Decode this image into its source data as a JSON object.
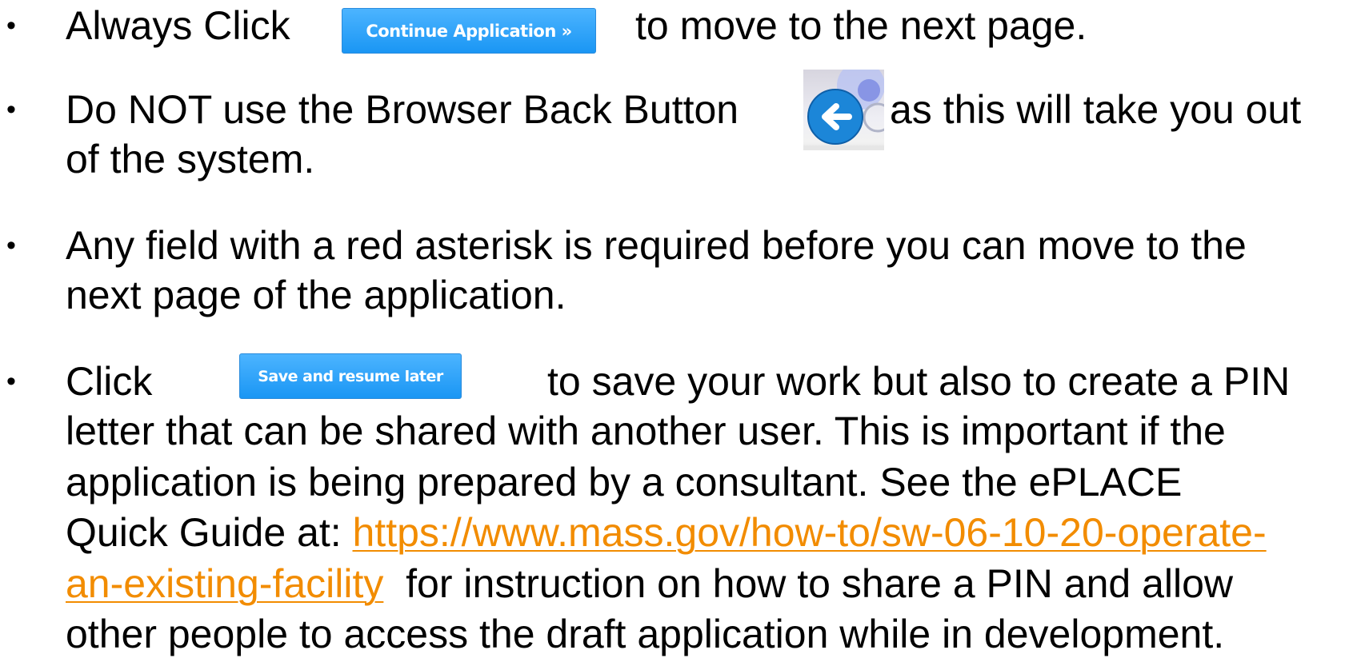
{
  "bullet_char": "•",
  "items": [
    {
      "before": "Always Click",
      "button_label": "Continue Application »",
      "after": "to move to the next page."
    },
    {
      "before": "Do NOT use the Browser Back Button",
      "icon": "browser-back-arrow-icon",
      "after": "as this will take you out",
      "line2": "of the system."
    },
    {
      "line1": "Any field with a red asterisk is required before you can move to the",
      "line2": "next page of the application."
    },
    {
      "before": "Click",
      "button_label": "Save and resume later",
      "after": "to save your work but also to create a PIN",
      "line2": "letter that can be shared with another user. This is important if the",
      "line3": "application is being prepared by a consultant. See the ePLACE",
      "line4_text": "Quick Guide at: ",
      "link_part1": "https://www.mass.gov/how-to/sw-06-10-20-operate-",
      "link_part2": "an-existing-facility",
      "line5_after": "  for instruction on how to share a PIN and allow",
      "line6": "other people to access the draft application while in development."
    }
  ],
  "colors": {
    "button_blue": "#1a96f4",
    "link_orange": "#f28c00",
    "back_circle": "#1c86d8"
  }
}
